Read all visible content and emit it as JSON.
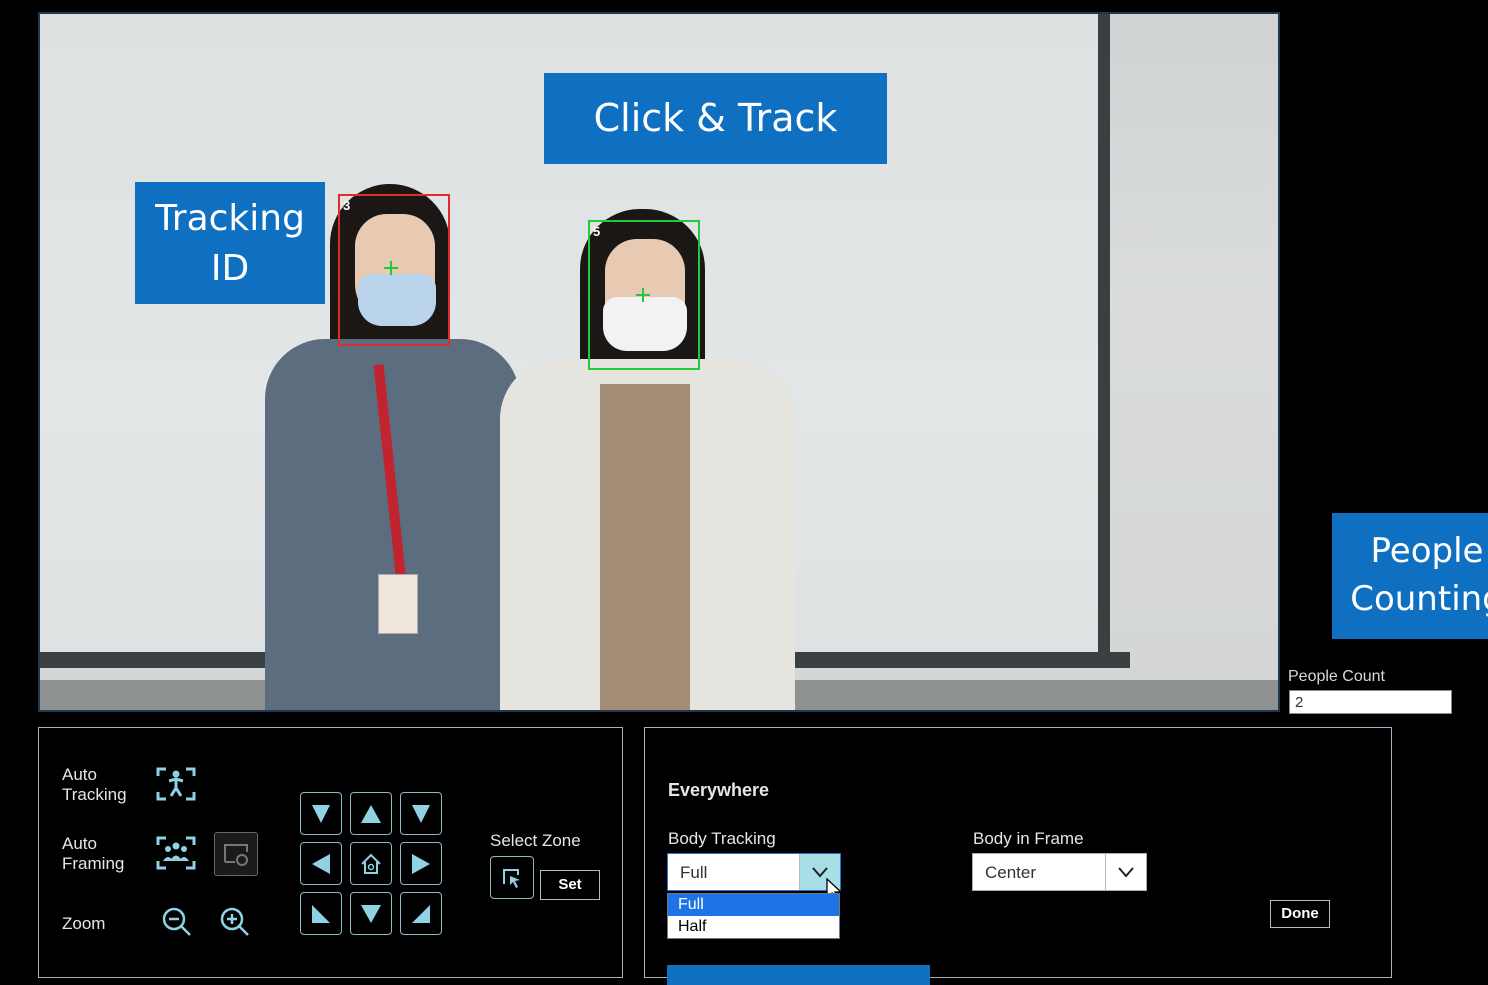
{
  "callouts": {
    "click_track": "Click & Track",
    "tracking_id": "Tracking ID",
    "people_counting": "People Counting"
  },
  "video": {
    "person_a_id": "3",
    "person_b_id": "5",
    "box_colors": {
      "selected": "#e02b2b",
      "tracked": "#22c93a"
    }
  },
  "people_count": {
    "label": "People Count",
    "value": "2"
  },
  "left_panel": {
    "auto_tracking_label": "Auto Tracking",
    "auto_framing_label": "Auto Framing",
    "zoom_label": "Zoom",
    "select_zone_label": "Select Zone",
    "set_button": "Set",
    "icons": [
      "person-tracking-icon",
      "group-framing-icon",
      "framing-reset-icon",
      "zoom-out-icon",
      "zoom-in-icon",
      "select-zone-icon",
      "home-icon"
    ]
  },
  "right_panel": {
    "heading": "Everywhere",
    "body_tracking_label": "Body Tracking",
    "body_tracking_value": "Full",
    "body_tracking_options": [
      "Full",
      "Half"
    ],
    "body_in_frame_label": "Body in Frame",
    "body_in_frame_value": "Center",
    "done_button": "Done"
  },
  "colors": {
    "accent": "#0f6fc0",
    "panel_border": "#9fb3c4",
    "dpad_border": "#8fb6c9",
    "selected_option": "#1e73e6"
  }
}
